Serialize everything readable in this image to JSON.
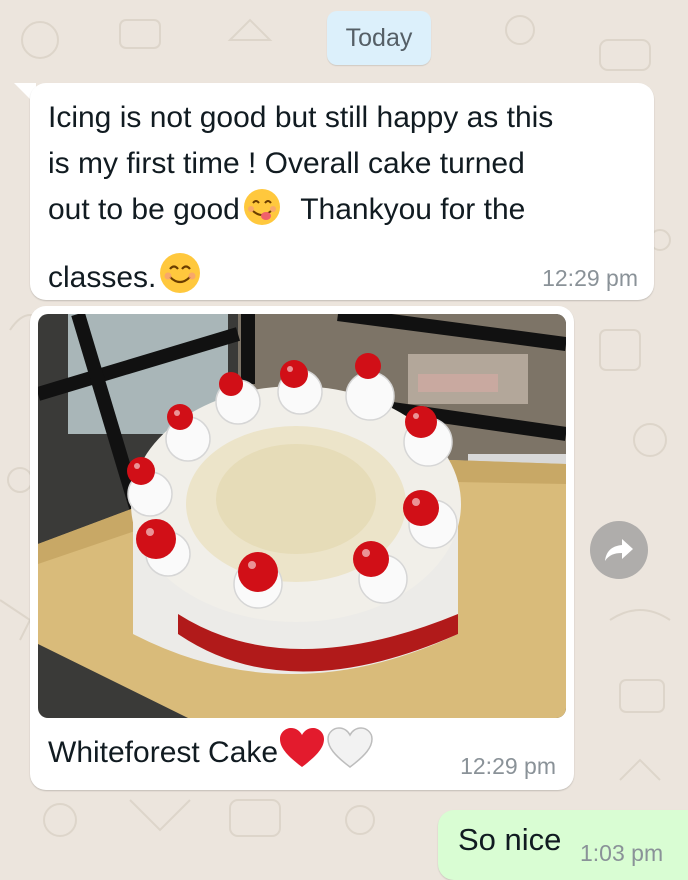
{
  "chat": {
    "date_label": "Today",
    "messages": [
      {
        "direction": "incoming",
        "line1": "Icing is not good but still happy as this",
        "line2": "is my first time ! Overall cake turned",
        "line3a": "out to be good",
        "line3b": "Thankyou for the",
        "line4": "classes.",
        "emojis": [
          "savoring-face-emoji",
          "smiling-face-emoji"
        ],
        "time": "12:29 pm"
      },
      {
        "direction": "incoming",
        "image_alt": "Photo of a white forest cake with cherries on a gold cake board",
        "caption": "Whiteforest Cake",
        "emojis": [
          "red-heart-emoji",
          "white-heart-emoji"
        ],
        "time": "12:29 pm"
      },
      {
        "direction": "outgoing",
        "text": "So nice",
        "time": "1:03 pm"
      }
    ]
  },
  "colors": {
    "wallpaper": "#ece5dd",
    "incoming_bubble": "#ffffff",
    "outgoing_bubble": "#d9fdd3",
    "date_chip": "#dcf0fb",
    "timestamp": "#8a9298"
  },
  "icons": {
    "forward": "forward-arrow-icon"
  }
}
